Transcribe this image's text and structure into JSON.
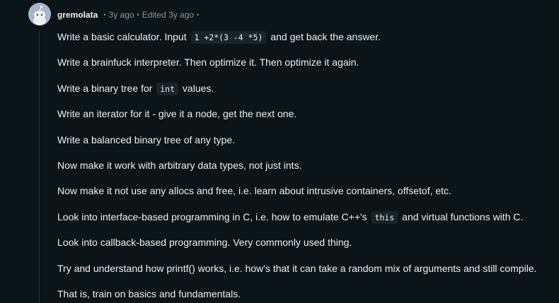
{
  "comment": {
    "author": "gremolata",
    "time_ago": "3y ago",
    "edited": "Edited 3y ago",
    "separator": "•",
    "paragraphs": [
      {
        "before": "Write a basic calculator. Input ",
        "code": "1 +2*(3 -4 *5)",
        "after": " and get back the answer."
      },
      {
        "text": "Write a brainfuck interpreter. Then optimize it. Then optimize it again."
      },
      {
        "before": "Write a binary tree for ",
        "code": "int",
        "after": " values."
      },
      {
        "text": "Write an iterator for it - give it a node, get the next one."
      },
      {
        "text": "Write a balanced binary tree of any type."
      },
      {
        "text": "Now make it work with arbitrary data types, not just ints."
      },
      {
        "text": "Now make it not use any allocs and free, i.e. learn about intrusive containers, offsetof, etc."
      },
      {
        "before": "Look into interface-based programming in C, i.e. how to emulate C++'s ",
        "code": "this",
        "after": " and virtual functions with C."
      },
      {
        "text": "Look into callback-based programming. Very commonly used thing."
      },
      {
        "text": "Try and understand how printf() works, i.e. how's that it can take a random mix of arguments and still compile."
      },
      {
        "text": "That is, train on basics and fundamentals."
      }
    ]
  },
  "icons": {
    "avatar": "snoo-avatar-icon"
  },
  "colors": {
    "background": "#0b1416",
    "text": "#eef1f3",
    "muted": "#8c969b",
    "code_background": "#1a2327",
    "thread_line": "#2a3236",
    "avatar_background": "#a4b6c8"
  }
}
